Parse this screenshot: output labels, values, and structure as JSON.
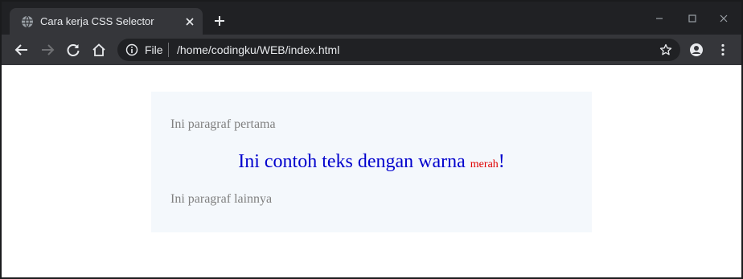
{
  "tab": {
    "title": "Cara kerja CSS Selector"
  },
  "address_bar": {
    "scheme_label": "File",
    "url": "/home/codingku/WEB/index.html"
  },
  "page": {
    "paragraph_first": "Ini paragraf pertama",
    "headline_text": "Ini contoh teks dengan warna",
    "headline_red_word": "merah",
    "headline_end": "!",
    "paragraph_other": "Ini paragraf lainnya"
  },
  "colors": {
    "chrome_dark": "#202124",
    "toolbar": "#35363a",
    "headline_blue": "#0000cd",
    "red_word": "#e00000",
    "paragraph_gray": "#808080",
    "container_bg": "#f4f8fc"
  }
}
